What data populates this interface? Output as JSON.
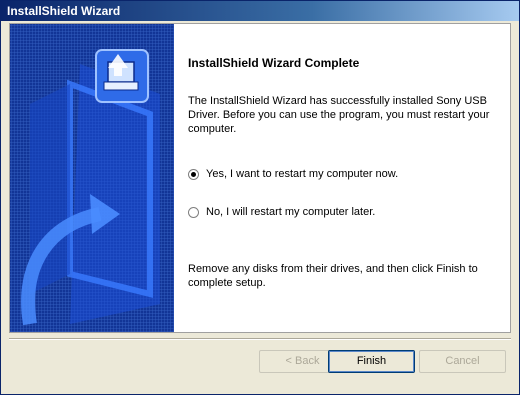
{
  "window": {
    "title": "InstallShield Wizard"
  },
  "content": {
    "heading": "InstallShield Wizard Complete",
    "description": "The InstallShield Wizard has successfully installed Sony USB Driver.  Before you can use the program, you must restart your computer.",
    "options": [
      {
        "label": "Yes, I want to restart my computer now.",
        "checked": true
      },
      {
        "label": "No, I will restart my computer later.",
        "checked": false
      }
    ],
    "note": "Remove any disks from their drives, and then click Finish to complete setup."
  },
  "buttons": {
    "back": "< Back",
    "finish": "Finish",
    "cancel": "Cancel"
  },
  "colors": {
    "banner": "#0a2a8c",
    "titlebar": "#0a246a"
  },
  "icons": {
    "banner_graphic": "installshield-computer-arrow",
    "setup_icon": "setup-computer-icon"
  }
}
